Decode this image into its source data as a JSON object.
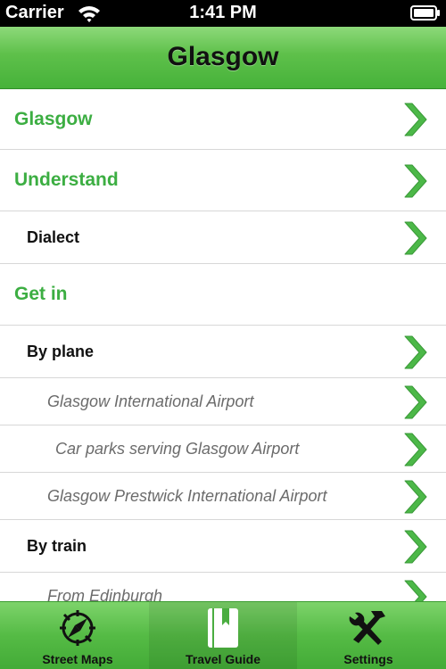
{
  "status_bar": {
    "carrier": "Carrier",
    "time": "1:41 PM"
  },
  "nav_bar": {
    "title": "Glasgow"
  },
  "list": [
    {
      "label": "Glasgow",
      "level": 1,
      "has_chevron": true
    },
    {
      "label": "Understand",
      "level": 1,
      "has_chevron": true
    },
    {
      "label": "Dialect",
      "level": 2,
      "has_chevron": true
    },
    {
      "label": "Get in",
      "level": 1,
      "has_chevron": false
    },
    {
      "label": "By plane",
      "level": 2,
      "has_chevron": true
    },
    {
      "label": "Glasgow International Airport",
      "level": 3,
      "has_chevron": true
    },
    {
      "label": "Car parks serving Glasgow Airport",
      "level": 4,
      "has_chevron": true
    },
    {
      "label": "Glasgow Prestwick International Airport",
      "level": 3,
      "has_chevron": true
    },
    {
      "label": "By train",
      "level": 2,
      "has_chevron": true
    },
    {
      "label": "From Edinburgh",
      "level": 3,
      "has_chevron": true
    }
  ],
  "tab_bar": {
    "tabs": [
      {
        "label": "Street Maps",
        "icon": "compass-icon",
        "selected": false
      },
      {
        "label": "Travel Guide",
        "icon": "book-icon",
        "selected": true
      },
      {
        "label": "Settings",
        "icon": "tools-icon",
        "selected": false
      }
    ]
  },
  "colors": {
    "accent_green": "#3cae42",
    "nav_green": "#5ec04a",
    "chevron_green": "#4cb848"
  }
}
